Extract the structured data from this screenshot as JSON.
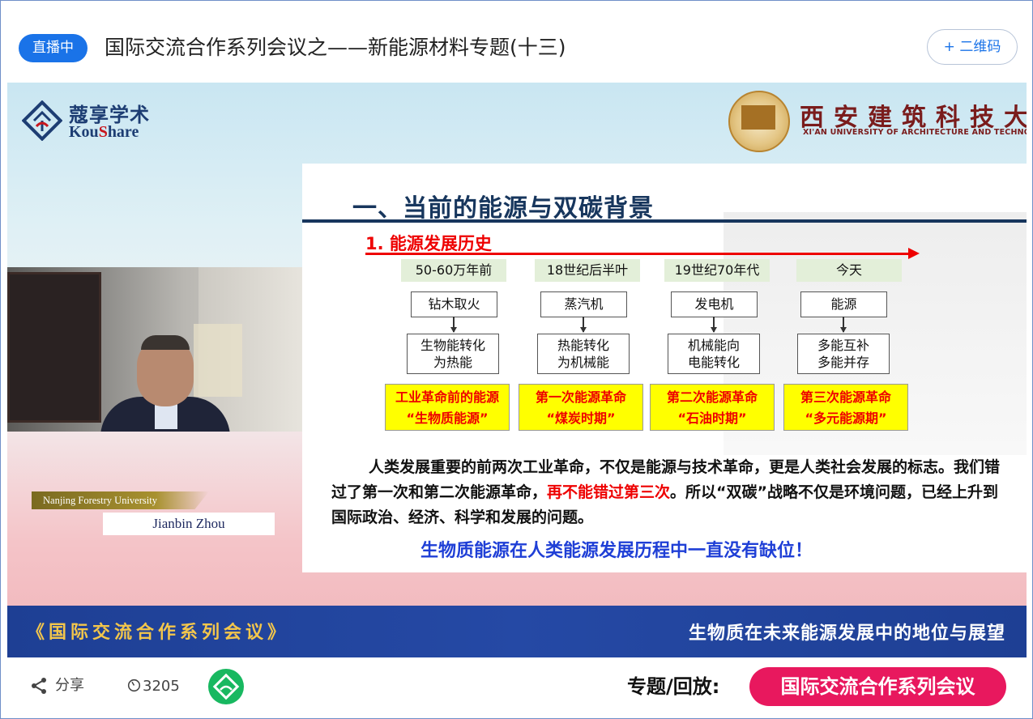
{
  "header": {
    "live_badge": "直播中",
    "title": "国际交流合作系列会议之——新能源材料专题(十三)",
    "qr_button": "+ 二维码"
  },
  "video": {
    "logo": {
      "cn": "蔻享学术",
      "en_prefix": "Kou",
      "en_mid": "S",
      "en_suffix": "hare"
    },
    "university": {
      "cn": "西安建筑科技大学",
      "en": "XI'AN UNIVERSITY OF ARCHITECTURE AND TECHNOLOGY"
    },
    "speaker": {
      "affiliation": "Nanjing Forestry University",
      "name": "Jianbin Zhou"
    },
    "slide": {
      "title": "一、当前的能源与双碳背景",
      "section": "1. 能源发展历史",
      "stages": [
        {
          "era": "50-60万年前",
          "tech": "钻木取火",
          "conv1": "生物能转化",
          "conv2": "为热能",
          "rev1": "工业革命前的能源",
          "rev2": "“生物质能源”"
        },
        {
          "era": "18世纪后半叶",
          "tech": "蒸汽机",
          "conv1": "热能转化",
          "conv2": "为机械能",
          "rev1": "第一次能源革命",
          "rev2": "“煤炭时期”"
        },
        {
          "era": "19世纪70年代",
          "tech": "发电机",
          "conv1": "机械能向",
          "conv2": "电能转化",
          "rev1": "第二次能源革命",
          "rev2": "“石油时期”"
        },
        {
          "era": "今天",
          "tech": "能源",
          "conv1": "多能互补",
          "conv2": "多能并存",
          "rev1": "第三次能源革命",
          "rev2": "“多元能源期”"
        }
      ],
      "para_a": "人类发展重要的前两次工业革命，不仅是能源与技术革命，更是人类社会发展的标志。我们错过了第一次和第二次能源革命，",
      "para_red": "再不能错过第三次",
      "para_b": "。所以“双碳”战略不仅是环境问题，已经上升到国际政治、经济、科学和发展的问题。",
      "conclusion": "生物质能源在人类能源发展历程中一直没有缺位！"
    },
    "banner": {
      "left": "《国际交流合作系列会议》",
      "right": "生物质在未来能源发展中的地位与展望"
    }
  },
  "footer": {
    "share_label": "分享",
    "share_icon": "share-icon",
    "views": "3205",
    "views_icon": "clock-icon",
    "topic_label": "专题/回放:",
    "topic_button": "国际交流合作系列会议"
  },
  "colors": {
    "accent": "#1a73e8",
    "topic_button": "#e8185e",
    "banner": "#1e3f94",
    "slide_red": "#ee0000",
    "slide_blue": "#1f3fd6"
  }
}
